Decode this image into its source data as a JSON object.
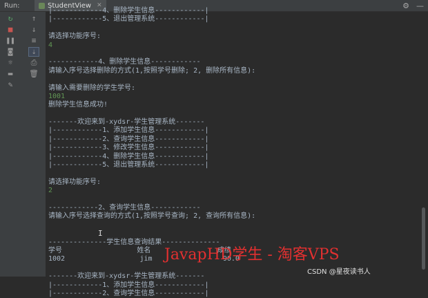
{
  "header": {
    "run_label": "Run:",
    "tab_title": "StudentView"
  },
  "console_lines": [
    {
      "text": "|------------4、删除学生信息------------|",
      "type": "normal"
    },
    {
      "text": "|------------5、退出管理系统------------|",
      "type": "normal"
    },
    {
      "text": "",
      "type": "normal"
    },
    {
      "text": "请选择功能序号:",
      "type": "normal"
    },
    {
      "text": "4",
      "type": "input"
    },
    {
      "text": "",
      "type": "normal"
    },
    {
      "text": "------------4、删除学生信息------------",
      "type": "normal"
    },
    {
      "text": "请输入序号选择删除的方式(1,按照学号删除; 2, 删除所有信息):",
      "type": "normal"
    },
    {
      "text": "",
      "type": "normal"
    },
    {
      "text": "请输入需要删除的学生学号:",
      "type": "normal"
    },
    {
      "text": "1001",
      "type": "input"
    },
    {
      "text": "删除学生信息成功!",
      "type": "normal"
    },
    {
      "text": "",
      "type": "normal"
    },
    {
      "text": "-------欢迎来到-xydsr-学生管理系统-------",
      "type": "normal"
    },
    {
      "text": "|------------1、添加学生信息------------|",
      "type": "normal"
    },
    {
      "text": "|------------2、查询学生信息------------|",
      "type": "normal"
    },
    {
      "text": "|------------3、修改学生信息------------|",
      "type": "normal"
    },
    {
      "text": "|------------4、删除学生信息------------|",
      "type": "normal"
    },
    {
      "text": "|------------5、退出管理系统------------|",
      "type": "normal"
    },
    {
      "text": "",
      "type": "normal"
    },
    {
      "text": "请选择功能序号:",
      "type": "normal"
    },
    {
      "text": "2",
      "type": "input"
    },
    {
      "text": "",
      "type": "normal"
    },
    {
      "text": "------------2、查询学生信息------------",
      "type": "normal"
    },
    {
      "text": "请输入序号选择查询的方式(1,按照学号查询; 2, 查询所有信息):",
      "type": "normal"
    },
    {
      "text": "",
      "type": "normal"
    },
    {
      "text": "",
      "type": "normal"
    },
    {
      "text": "--------------学生信息查询结果--------------",
      "type": "normal"
    },
    {
      "text": "学号                  姓名                成绩",
      "type": "normal"
    },
    {
      "text": "1002                  jim                 90.0",
      "type": "normal"
    },
    {
      "text": "",
      "type": "normal"
    },
    {
      "text": "-------欢迎来到-xydsr-学生管理系统-------",
      "type": "normal"
    },
    {
      "text": "|------------1、添加学生信息------------|",
      "type": "normal"
    },
    {
      "text": "|------------2、查询学生信息------------|",
      "type": "normal"
    }
  ],
  "watermark": {
    "main": "JavapHD学生 - 淘客VPS",
    "credit": "CSDN @星夜读书人"
  },
  "icons": [
    "rerun-icon",
    "stop-icon",
    "pause-icon",
    "camera-icon",
    "settings-icon",
    "layout-icon",
    "pin-icon",
    "wrap-icon",
    "scroll-end-icon",
    "print-icon",
    "trash-icon",
    "gear-icon",
    "minimize-icon"
  ],
  "colors": {
    "background": "#2b2b2b",
    "text": "#a9b7c6",
    "input": "#629755",
    "watermark": "#e23030"
  }
}
